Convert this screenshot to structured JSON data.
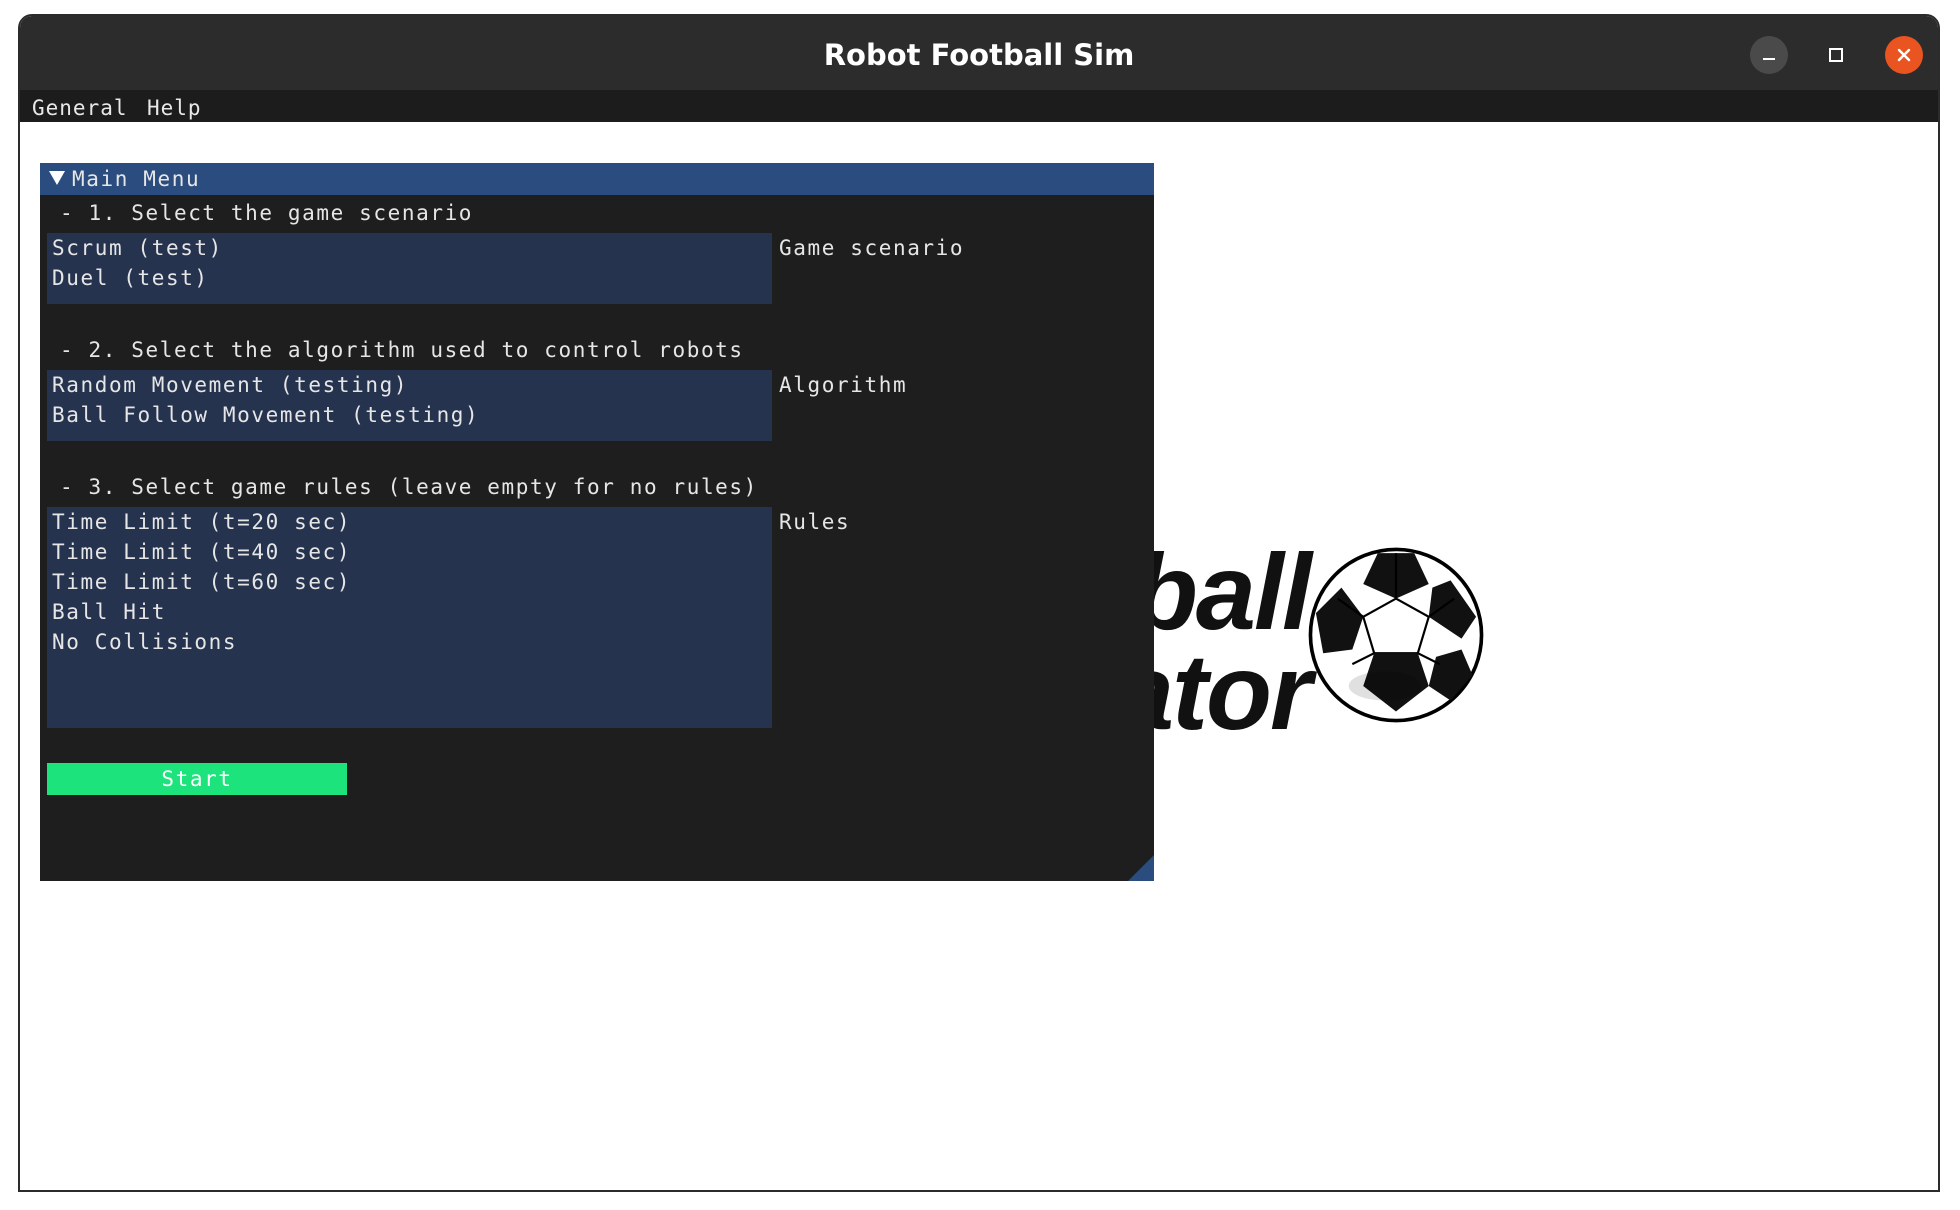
{
  "window": {
    "title": "Robot Football Sim",
    "controls": {
      "minimize_icon": "minimize-icon",
      "maximize_icon": "maximize-icon",
      "close_icon": "close-icon"
    }
  },
  "menubar": {
    "general": "General",
    "help": "Help"
  },
  "logo": {
    "line1": "Robot Football",
    "line2": "Simulator",
    "icon": "soccer-ball-icon"
  },
  "main_menu": {
    "title": "Main Menu",
    "step1": {
      "label": "- 1. Select the game scenario",
      "side_label": "Game scenario",
      "options": [
        "Scrum (test)",
        "Duel (test)"
      ]
    },
    "step2": {
      "label": "- 2. Select the algorithm used to control robots",
      "side_label": "Algorithm",
      "options": [
        "Random Movement (testing)",
        "Ball Follow Movement (testing)"
      ]
    },
    "step3": {
      "label": "- 3. Select game rules (leave empty for no rules)",
      "side_label": "Rules",
      "options": [
        "Time Limit (t=20 sec)",
        "Time Limit (t=40 sec)",
        "Time Limit (t=60 sec)",
        "Ball Hit",
        "No Collisions"
      ]
    },
    "start_button": "Start"
  },
  "colors": {
    "titlebar": "#2c2c2c",
    "panel_bg": "#1e1e1e",
    "panel_header": "#2b4c7e",
    "listbox": "#25334f",
    "start_button": "#1de37c",
    "close_button": "#e95420"
  }
}
